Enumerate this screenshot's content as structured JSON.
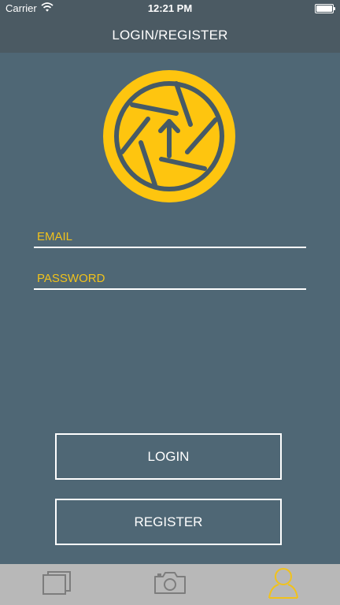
{
  "status_bar": {
    "carrier": "Carrier",
    "time": "12:21 PM",
    "wifi_icon": "wifi-icon",
    "battery_icon": "battery-icon"
  },
  "nav": {
    "title": "LOGIN/REGISTER"
  },
  "logo": {
    "icon": "camera-aperture-upload-icon",
    "colors": {
      "fill": "#fec50f",
      "stroke": "#465a66"
    }
  },
  "form": {
    "email_placeholder": "EMAIL",
    "password_placeholder": "PASSWORD"
  },
  "buttons": {
    "login_label": "LOGIN",
    "register_label": "REGISTER"
  },
  "tabs": [
    {
      "icon": "gallery-icon",
      "active": false
    },
    {
      "icon": "camera-icon",
      "active": false
    },
    {
      "icon": "user-icon",
      "active": true
    }
  ],
  "colors": {
    "background": "#4f6775",
    "header": "#4b5a63",
    "accent": "#f1c21b",
    "tab_bar": "#b8b8b8",
    "tab_inactive": "#7d7d7d"
  }
}
